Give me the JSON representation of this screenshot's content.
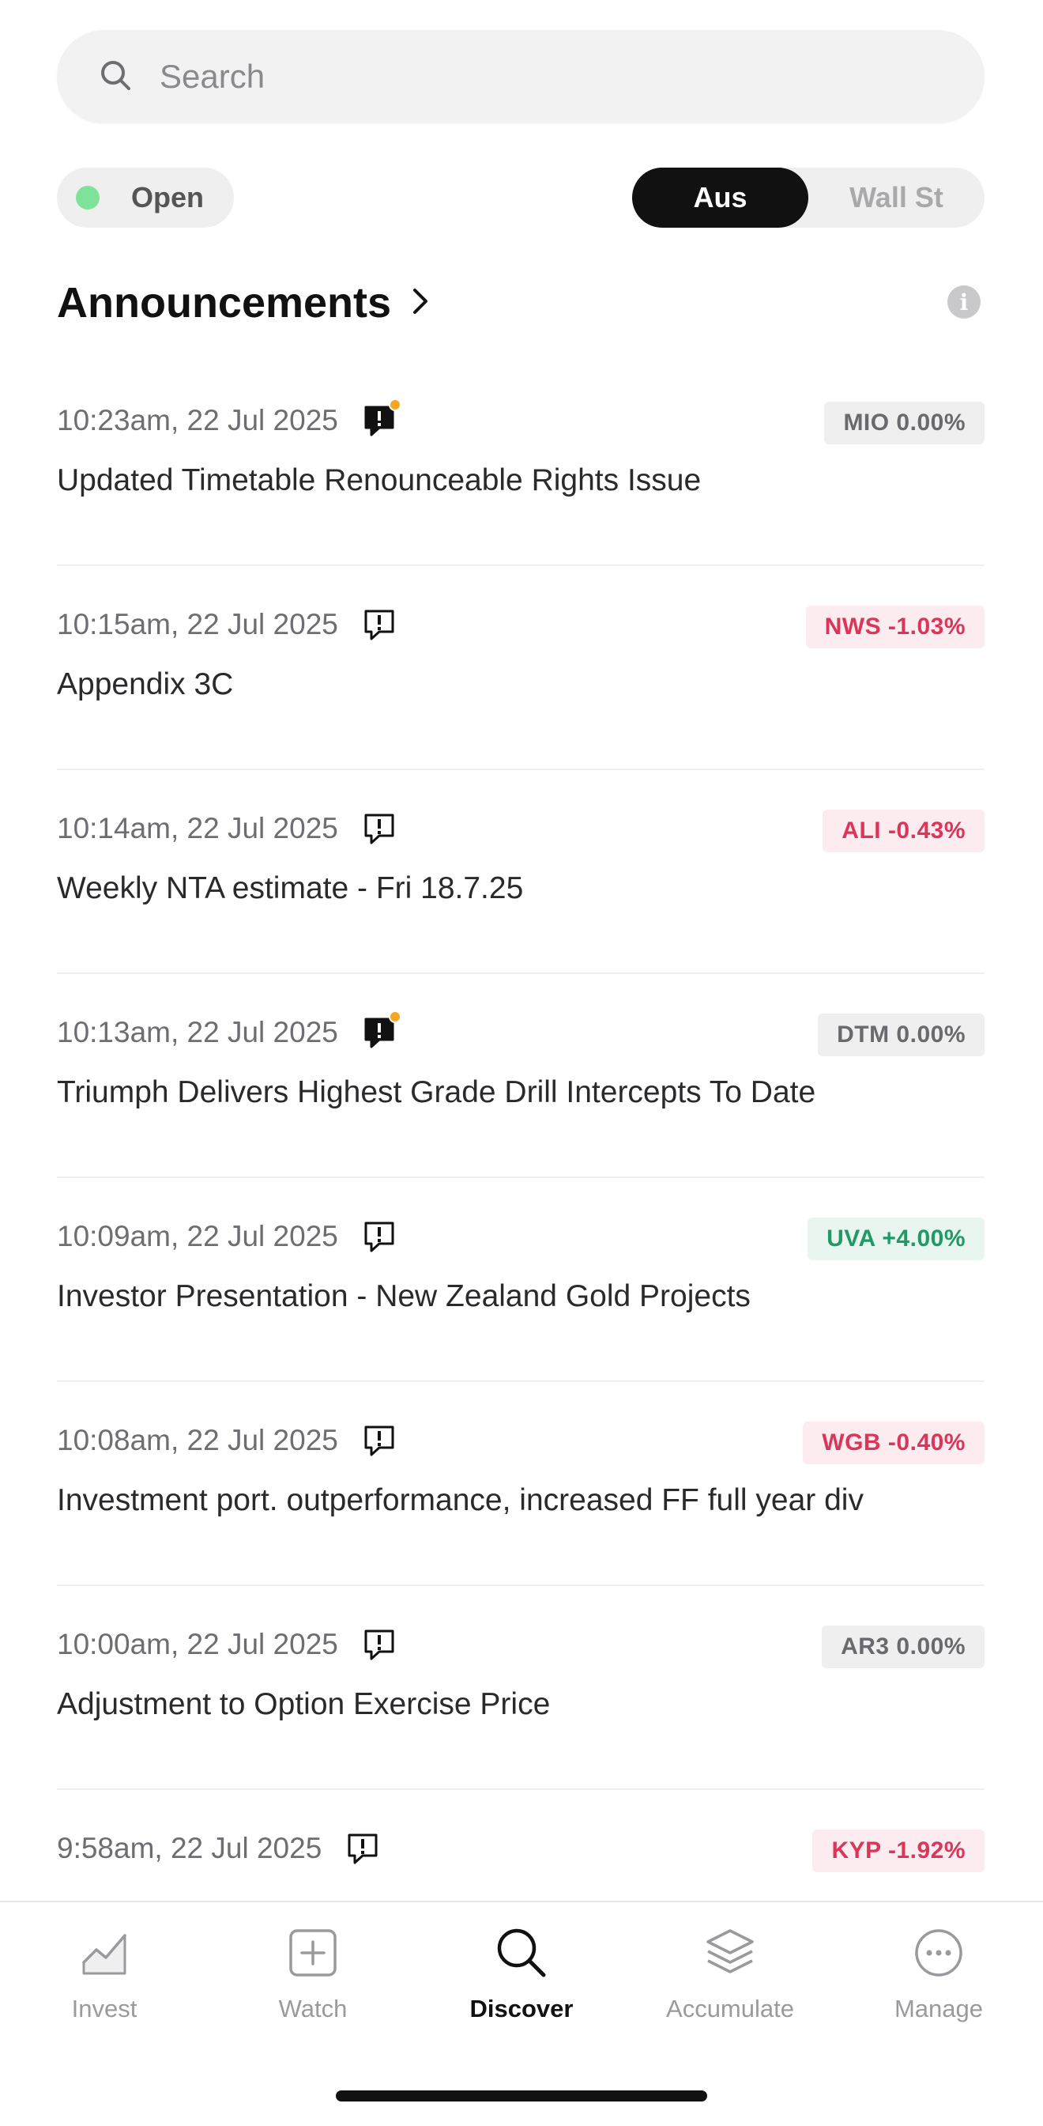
{
  "search": {
    "placeholder": "Search"
  },
  "market_status": {
    "label": "Open",
    "dot_color": "#7ee29a"
  },
  "market_toggle": {
    "options": [
      "Aus",
      "Wall St"
    ],
    "selected": "Aus"
  },
  "section": {
    "title": "Announcements"
  },
  "announcements": [
    {
      "time": "10:23am, 22 Jul 2025",
      "title": "Updated Timetable Renounceable Rights Issue",
      "ticker_change": "MIO 0.00%",
      "tone": "neutral",
      "price_sensitive": true
    },
    {
      "time": "10:15am, 22 Jul 2025",
      "title": "Appendix 3C",
      "ticker_change": "NWS -1.03%",
      "tone": "neg",
      "price_sensitive": false
    },
    {
      "time": "10:14am, 22 Jul 2025",
      "title": "Weekly NTA estimate - Fri 18.7.25",
      "ticker_change": "ALI -0.43%",
      "tone": "neg",
      "price_sensitive": false
    },
    {
      "time": "10:13am, 22 Jul 2025",
      "title": "Triumph Delivers Highest Grade Drill Intercepts To Date",
      "ticker_change": "DTM 0.00%",
      "tone": "neutral",
      "price_sensitive": true
    },
    {
      "time": "10:09am, 22 Jul 2025",
      "title": "Investor Presentation - New Zealand Gold Projects",
      "ticker_change": "UVA +4.00%",
      "tone": "pos",
      "price_sensitive": false
    },
    {
      "time": "10:08am, 22 Jul 2025",
      "title": "Investment port. outperformance, increased FF full year div",
      "ticker_change": "WGB -0.40%",
      "tone": "neg",
      "price_sensitive": false
    },
    {
      "time": "10:00am, 22 Jul 2025",
      "title": "Adjustment to Option Exercise Price",
      "ticker_change": "AR3 0.00%",
      "tone": "neutral",
      "price_sensitive": false
    },
    {
      "time": "9:58am, 22 Jul 2025",
      "title": "",
      "ticker_change": "KYP -1.92%",
      "tone": "neg",
      "price_sensitive": false
    }
  ],
  "tabbar": {
    "items": [
      {
        "label": "Invest",
        "icon": "chart-line-icon"
      },
      {
        "label": "Watch",
        "icon": "plus-square-icon"
      },
      {
        "label": "Discover",
        "icon": "search-icon"
      },
      {
        "label": "Accumulate",
        "icon": "layers-icon"
      },
      {
        "label": "Manage",
        "icon": "more-circle-icon"
      }
    ],
    "active": "Discover"
  },
  "colors": {
    "negative": "#d9365a",
    "positive": "#1f9a67",
    "neutral": "#6a6a6e",
    "alert_dot": "#f5a623"
  }
}
